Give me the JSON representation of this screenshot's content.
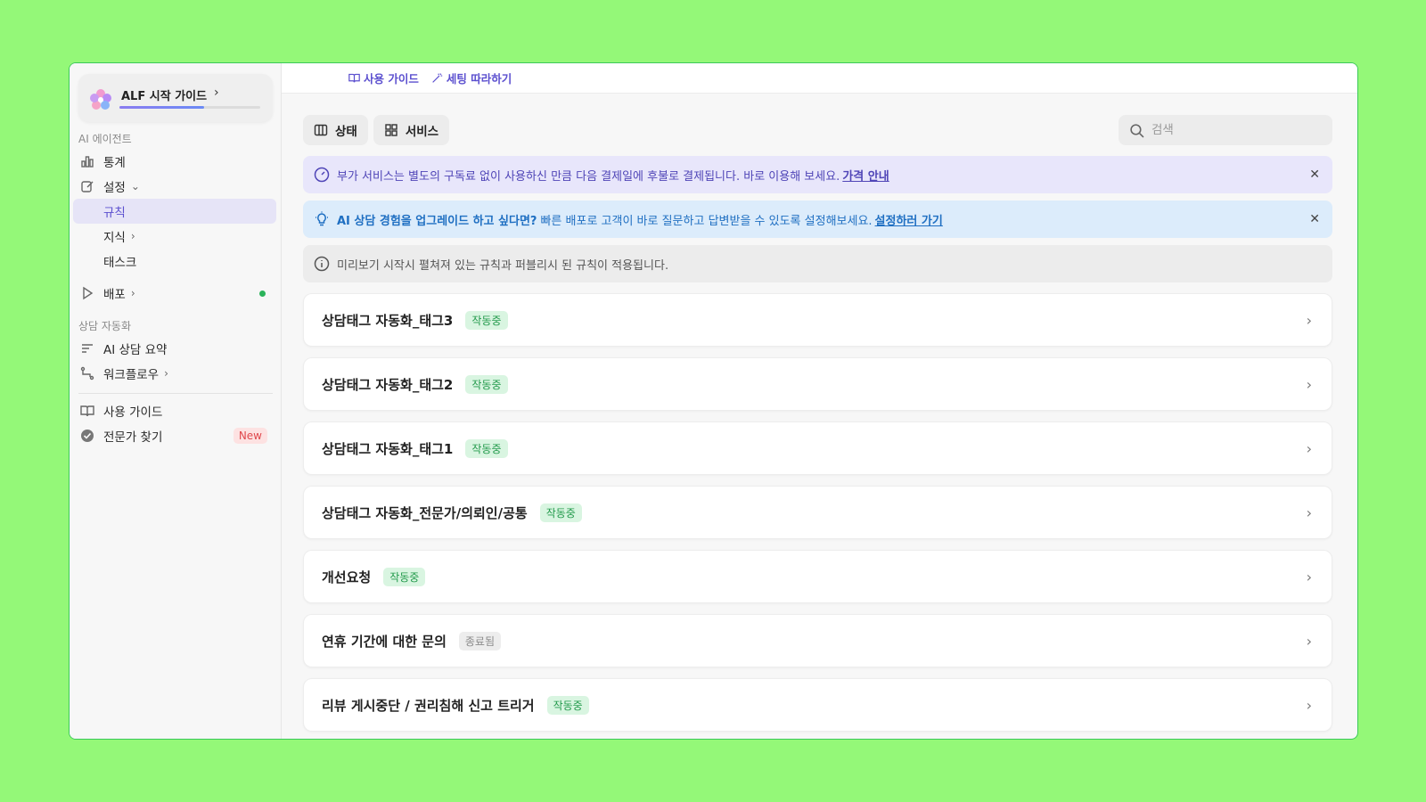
{
  "guide": {
    "title": "ALF 시작 가이드",
    "progress": 0.6
  },
  "sidebar": {
    "section_ai": "AI 에이전트",
    "items_ai": [
      {
        "label": "통계"
      },
      {
        "label": "설정"
      },
      {
        "label": "규칙"
      },
      {
        "label": "지식"
      },
      {
        "label": "태스크"
      },
      {
        "label": "배포"
      }
    ],
    "section_auto": "상담 자동화",
    "items_auto": [
      {
        "label": "AI 상담 요약"
      },
      {
        "label": "워크플로우"
      }
    ],
    "items_bottom": [
      {
        "label": "사용 가이드"
      },
      {
        "label": "전문가 찾기",
        "badge": "New"
      }
    ]
  },
  "topbar": {
    "guide_link": "사용 가이드",
    "setup_link": "세팅 따라하기"
  },
  "toolbar": {
    "status_label": "상태",
    "service_label": "서비스"
  },
  "search": {
    "placeholder": "검색"
  },
  "banners": {
    "addon": {
      "text": "부가 서비스는 별도의 구독료 없이 사용하신 만큼 다음 결제일에 후불로 결제됩니다. 바로 이용해 보세요.",
      "link": "가격 안내"
    },
    "upgrade": {
      "bold": "AI 상담 경험을 업그레이드 하고 싶다면?",
      "text": "빠른 배포로 고객이 바로 질문하고 답변받을 수 있도록 설정해보세요.",
      "link": "설정하러 가기"
    },
    "preview": {
      "text": "미리보기 시작시 펼쳐져 있는 규칙과 퍼블리시 된 규칙이 적용됩니다."
    }
  },
  "rules": [
    {
      "title": "상담태그 자동화_태그3",
      "status": "작동중"
    },
    {
      "title": "상담태그 자동화_태그2",
      "status": "작동중"
    },
    {
      "title": "상담태그 자동화_태그1",
      "status": "작동중"
    },
    {
      "title": "상담태그 자동화_전문가/의뢰인/공통",
      "status": "작동중"
    },
    {
      "title": "개선요청",
      "status": "작동중"
    },
    {
      "title": "연휴 기간에 대한 문의",
      "status": "종료됨"
    },
    {
      "title": "리뷰 게시중단 / 권리침해 신고 트리거",
      "status": "작동중"
    }
  ],
  "colors": {
    "accent": "#5b4fcf",
    "active_badge": "#239a4c",
    "background": "#94f878"
  }
}
